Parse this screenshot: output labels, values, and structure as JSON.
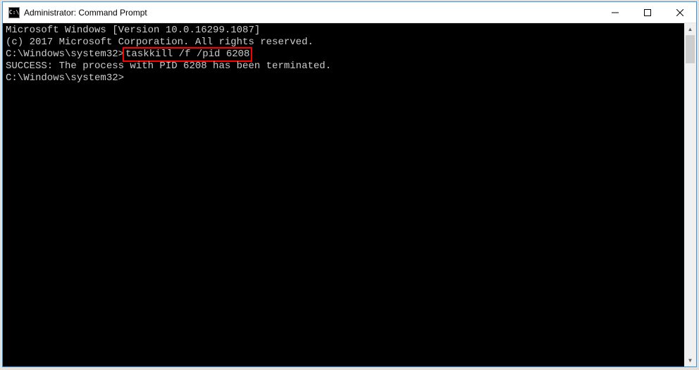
{
  "titlebar": {
    "icon_label": "C:\\",
    "title": "Administrator: Command Prompt"
  },
  "terminal": {
    "line1": "Microsoft Windows [Version 10.0.16299.1087]",
    "line2": "(c) 2017 Microsoft Corporation. All rights reserved.",
    "blank1": "",
    "prompt1_path": "C:\\Windows\\system32>",
    "prompt1_cmd": "taskkill /f /pid 6208",
    "result1": "SUCCESS: The process with PID 6208 has been terminated.",
    "blank2": "",
    "prompt2": "C:\\Windows\\system32>"
  }
}
